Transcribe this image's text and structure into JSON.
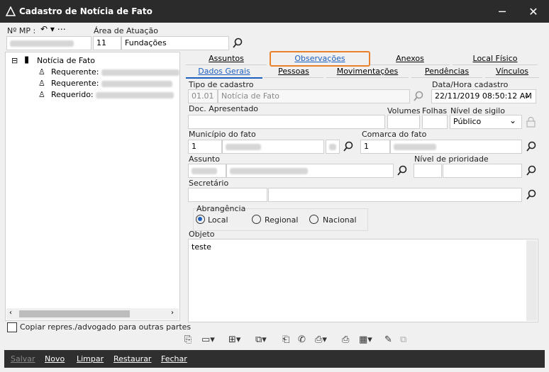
{
  "window": {
    "title": "Cadastro de Notícia de Fato",
    "minimize": "─",
    "close": "✕"
  },
  "top": {
    "mp_label": "Nº MP :",
    "area_label": "Área de Atuação",
    "area_code": "11",
    "area_name": "Fundações"
  },
  "tree": {
    "root": "Notícia de Fato",
    "children": [
      "Requerente:",
      "Requerente:",
      "Requerido:"
    ]
  },
  "copy_checkbox_label": "Copiar repres./advogado para outras partes",
  "tabs_row1": [
    "Assuntos",
    "Observações",
    "Anexos",
    "Local Físico"
  ],
  "tabs_row2": [
    "Dados Gerais",
    "Pessoas",
    "Movimentações",
    "Pendências",
    "Vínculos"
  ],
  "form": {
    "tipo_label": "Tipo de cadastro",
    "tipo_code": "01.01",
    "tipo_name": "Notícia de Fato",
    "data_label": "Data/Hora cadastro",
    "data_value": "22/11/2019 08:50:12 AM",
    "doc_label": "Doc. Apresentado",
    "volumes_label": "Volumes",
    "folhas_label": "Folhas",
    "sigilo_label": "Nível de sigilo",
    "sigilo_value": "Público",
    "municipio_label": "Município do fato",
    "municipio_code": "1",
    "comarca_label": "Comarca do fato",
    "comarca_code": "1",
    "assunto_label": "Assunto",
    "prioridade_label": "Nível de prioridade",
    "secretario_label": "Secretário",
    "abrangencia_label": "Abrangência",
    "abrangencia_options": [
      "Local",
      "Regional",
      "Nacional"
    ],
    "abrangencia_selected": "Local",
    "objeto_label": "Objeto",
    "objeto_value": "teste"
  },
  "bottom_buttons": [
    "Salvar",
    "Novo",
    "Limpar",
    "Restaurar",
    "Fechar"
  ],
  "colors": {
    "highlight": "#e8822a",
    "tab_active": "#1d5fbf"
  }
}
